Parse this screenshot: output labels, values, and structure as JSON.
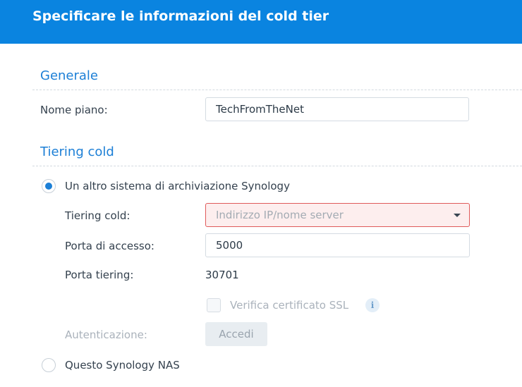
{
  "header": {
    "title": "Specificare le informazioni del cold tier"
  },
  "general": {
    "section_title": "Generale",
    "plan_name_label": "Nome piano:",
    "plan_name_value": "TechFromTheNet"
  },
  "cold_tiering": {
    "section_title": "Tiering cold",
    "option_other_synology": {
      "label": "Un altro sistema di archiviazione Synology",
      "selected": true
    },
    "tiering_cold_label": "Tiering cold:",
    "tiering_cold_placeholder": "Indirizzo IP/nome server",
    "access_port_label": "Porta di accesso:",
    "access_port_value": "5000",
    "tiering_port_label": "Porta tiering:",
    "tiering_port_value": "30701",
    "ssl_checkbox_label": "Verifica certificato SSL",
    "ssl_checked": false,
    "info_icon_glyph": "i",
    "authentication_label": "Autenticazione:",
    "login_button_label": "Accedi",
    "option_this_nas": {
      "label": "Questo Synology NAS",
      "selected": false
    }
  },
  "colors": {
    "header_bg": "#0a84e0",
    "section_title": "#1c7fd6",
    "error_border": "#e05a5a",
    "error_bg": "#fdeeee"
  }
}
